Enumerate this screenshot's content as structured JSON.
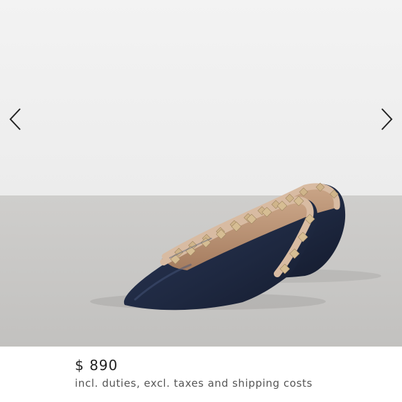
{
  "gallery": {
    "image_name": "navy-studded-pointed-flats",
    "prev_icon": "chevron-left-icon",
    "next_icon": "chevron-right-icon"
  },
  "product": {
    "price": "$ 890",
    "tax_note": "incl. duties, excl. taxes and shipping costs"
  },
  "colors": {
    "background_wall": "#f1f1f1",
    "floor": "#c9c8c6",
    "shoe_navy": "#1f2942",
    "trim_nude": "#d6b9a0",
    "stud_gold": "#cfb48a"
  }
}
